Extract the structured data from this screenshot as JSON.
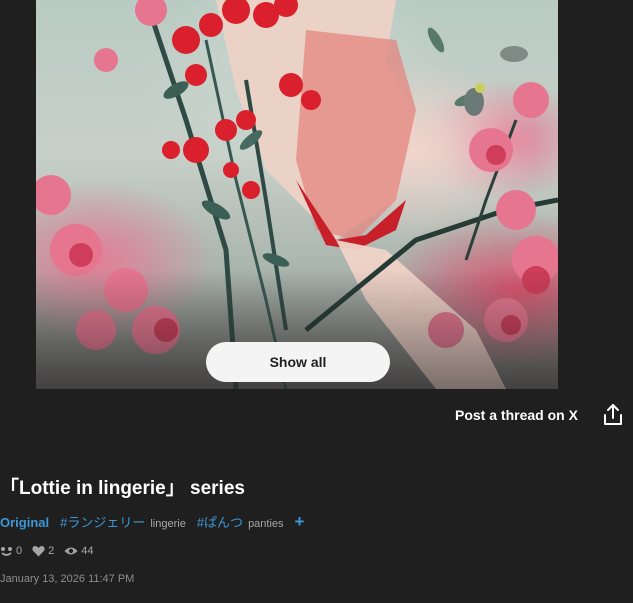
{
  "artwork": {
    "show_all_label": "Show all"
  },
  "actions": {
    "post_thread_label": "Post a thread on X",
    "share_icon": "share-icon"
  },
  "work": {
    "title": "「Lottie in lingerie」 series",
    "original_label": "Original",
    "tags": [
      {
        "name": "#ランジェリー",
        "translation": "lingerie"
      },
      {
        "name": "#ぱんつ",
        "translation": "panties"
      }
    ],
    "add_tag_label": "+"
  },
  "stats": {
    "requests": "0",
    "likes": "2",
    "views": "44",
    "icons": [
      "smile-icon",
      "heart-icon",
      "eye-icon"
    ]
  },
  "date": "January 13, 2026 11:47 PM",
  "colors": {
    "background": "#1f1f1f",
    "accent": "#3d97d6",
    "button": "#f4f4f4"
  }
}
